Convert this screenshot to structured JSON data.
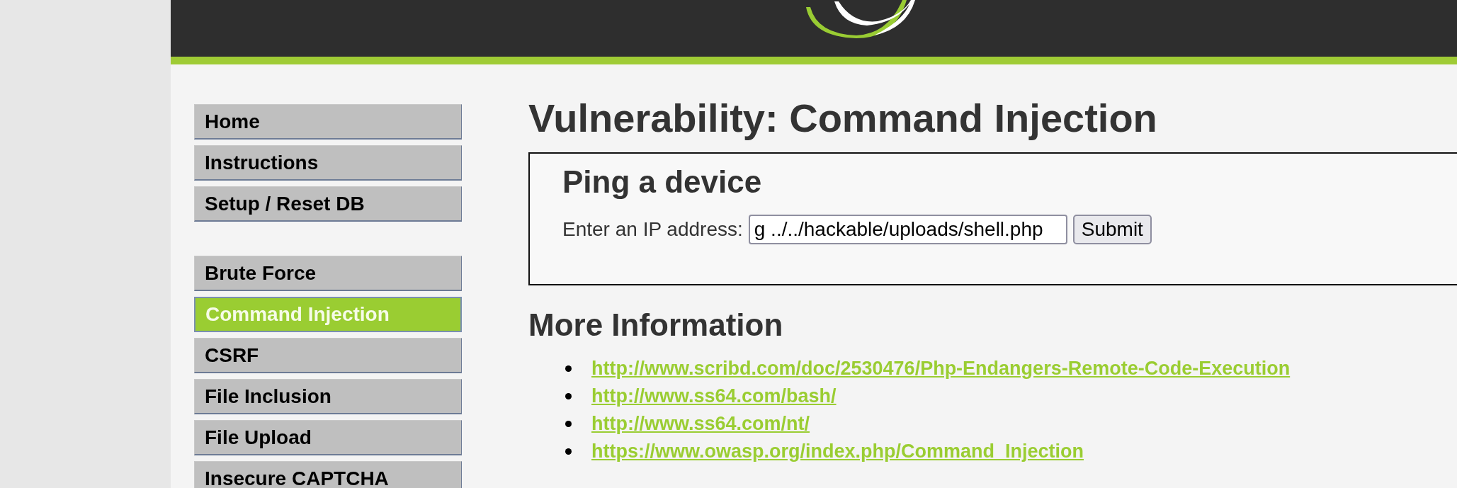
{
  "menu": [
    {
      "label": "Home",
      "selected": false
    },
    {
      "label": "Instructions",
      "selected": false
    },
    {
      "label": "Setup / Reset DB",
      "selected": false
    },
    {
      "label": "Brute Force",
      "selected": false,
      "group_start": true
    },
    {
      "label": "Command Injection",
      "selected": true
    },
    {
      "label": "CSRF",
      "selected": false
    },
    {
      "label": "File Inclusion",
      "selected": false
    },
    {
      "label": "File Upload",
      "selected": false
    },
    {
      "label": "Insecure CAPTCHA",
      "selected": false
    }
  ],
  "title": "Vulnerability: Command Injection",
  "form": {
    "heading": "Ping a device",
    "label": "Enter an IP address:",
    "value": "g ../../hackable/uploads/shell.php",
    "button": "Submit"
  },
  "more_info": {
    "heading": "More Information",
    "links": [
      "http://www.scribd.com/doc/2530476/Php-Endangers-Remote-Code-Execution",
      "http://www.ss64.com/bash/",
      "http://www.ss64.com/nt/",
      "https://www.owasp.org/index.php/Command_Injection"
    ]
  }
}
